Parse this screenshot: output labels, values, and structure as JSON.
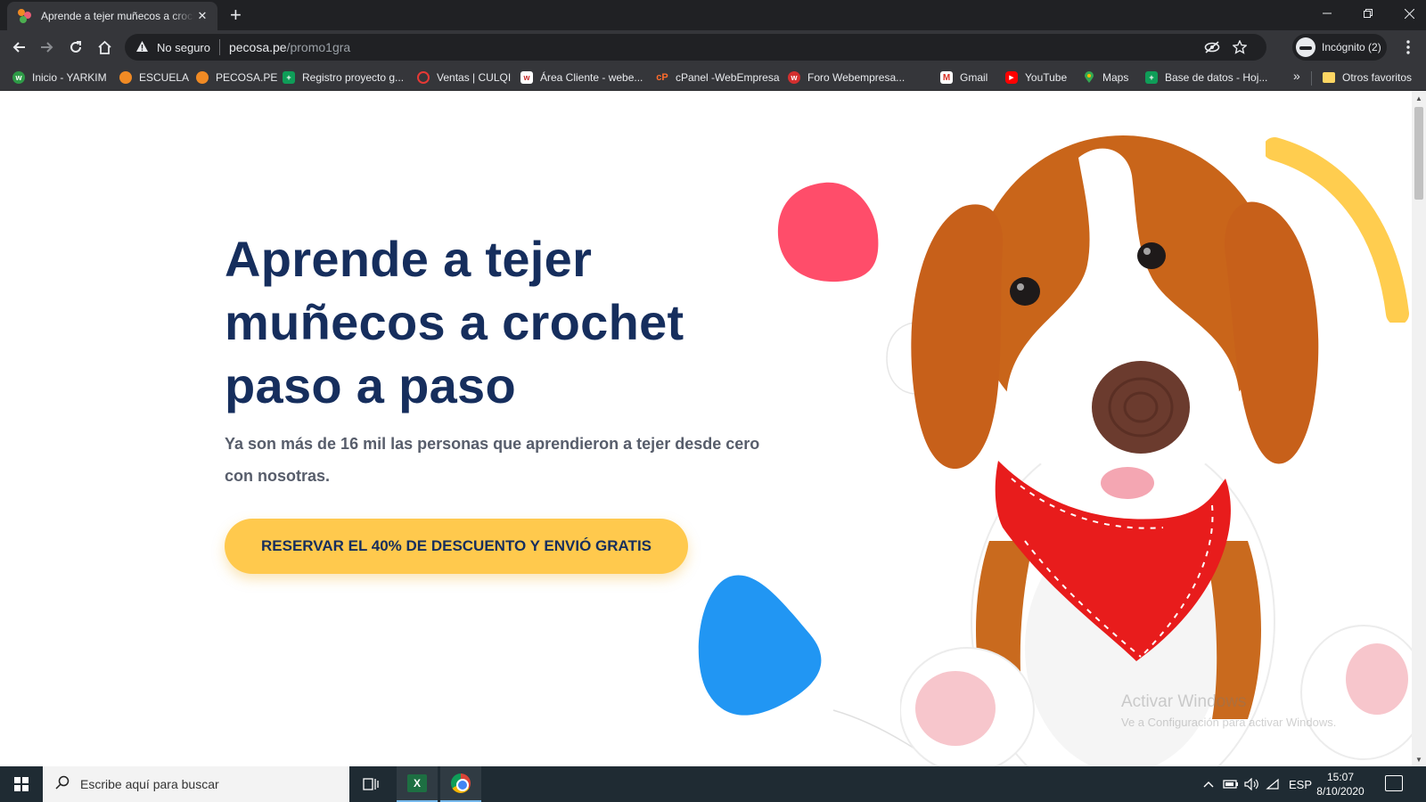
{
  "browser": {
    "tab_title": "Aprende a tejer muñecos a crochet",
    "tab_close": "✕",
    "new_tab": "+",
    "security_label": "No seguro",
    "url_host": "pecosa.pe",
    "url_path": "/promo1gra",
    "incognito_label": "Incógnito (2)"
  },
  "bookmarks": [
    {
      "label": "Inicio - YARKIM",
      "icon": "yarkim-icon",
      "color": "#2e9b47"
    },
    {
      "label": "ESCUELA",
      "icon": "pecosa-icon",
      "color": "#f08a24"
    },
    {
      "label": "PECOSA.PE",
      "icon": "pecosa-icon",
      "color": "#f08a24"
    },
    {
      "label": "Registro proyecto g...",
      "icon": "sheets-icon",
      "color": "#0f9d58"
    },
    {
      "label": "Ventas | CULQI",
      "icon": "culqi-icon",
      "color": "#1565c0"
    },
    {
      "label": "Área Cliente - webe...",
      "icon": "webempresa-icon",
      "color": "#c62828"
    },
    {
      "label": "cPanel -WebEmpresa",
      "icon": "cpanel-icon",
      "color": "#ff6c2c"
    },
    {
      "label": "Foro Webempresa...",
      "icon": "webempresa-icon",
      "color": "#d32f2f"
    },
    {
      "label": "Gmail",
      "icon": "gmail-icon",
      "color": "#d93025"
    },
    {
      "label": "YouTube",
      "icon": "youtube-icon",
      "color": "#ff0000"
    },
    {
      "label": "Maps",
      "icon": "maps-icon",
      "color": "#34a853"
    },
    {
      "label": "Base de datos - Hoj...",
      "icon": "sheets-icon",
      "color": "#0f9d58"
    }
  ],
  "bookmarks_more": "»",
  "other_bookmarks": "Otros favoritos",
  "hero": {
    "title": "Aprende a tejer muñecos a crochet paso a paso",
    "subtitle": "Ya son más de 16 mil las personas que aprendieron a tejer desde cero con nosotras.",
    "cta_label": "RESERVAR EL 40% DE DESCUENTO Y ENVIÓ GRATIS"
  },
  "watermark": {
    "title": "Activar Windows",
    "subtitle": "Ve a Configuración para activar Windows."
  },
  "taskbar": {
    "search_placeholder": "Escribe aquí para buscar",
    "language": "ESP",
    "time": "15:07",
    "date": "8/10/2020"
  },
  "colors": {
    "title": "#162e5d",
    "cta": "#ffc94d",
    "blob_red": "#ff4d6a",
    "blob_blue": "#2196f3",
    "arc_yellow": "#ffcd4f"
  }
}
